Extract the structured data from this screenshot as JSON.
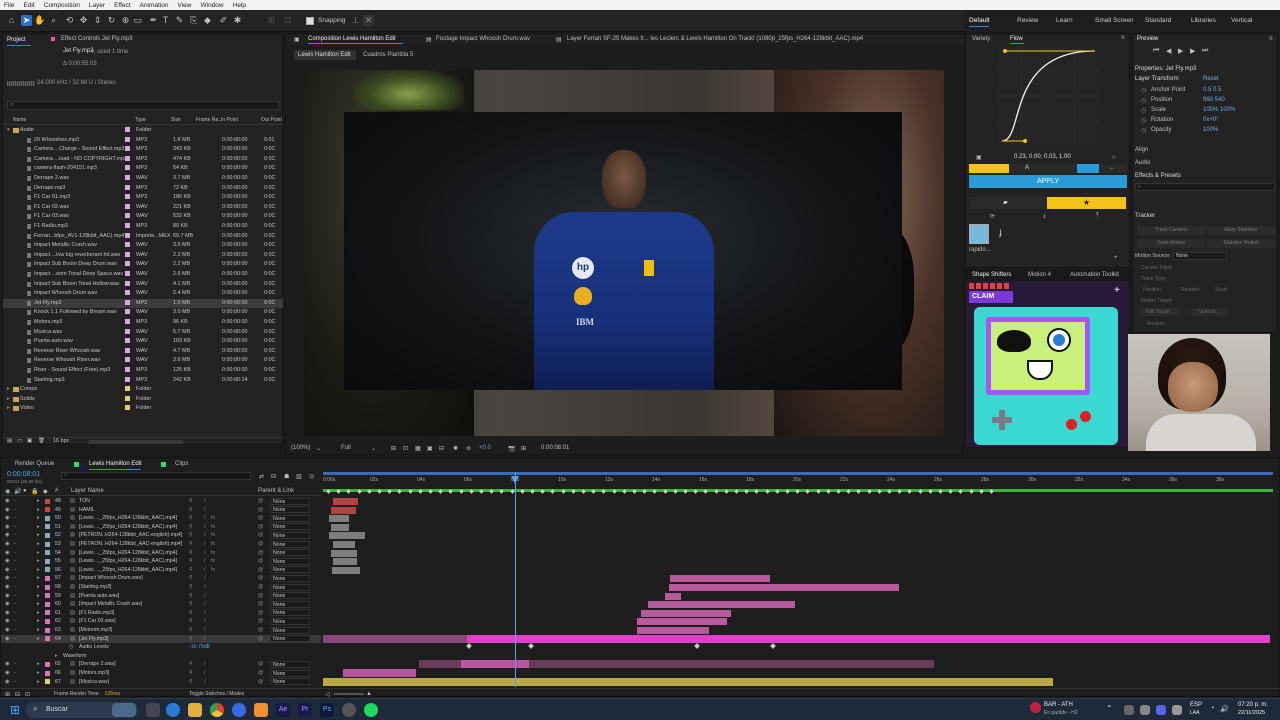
{
  "menu": [
    "File",
    "Edit",
    "Composition",
    "Layer",
    "Effect",
    "Animation",
    "View",
    "Window",
    "Help"
  ],
  "toolbar": {
    "snapping": "Snapping"
  },
  "workspaces": [
    "Default",
    "Review",
    "Learn",
    "Small Screen",
    "Standard",
    "Libraries",
    "Vertical"
  ],
  "project": {
    "tab": "Project",
    "effect_tab": "Effect Controls Jet Fly.mp3",
    "file_name": "Jet Fly.mp3",
    "file_used": "▾, used 1 time",
    "file_duration": "Δ 0:00:55:03",
    "file_info": "24.000 kHz / 32 bit U / Stereo",
    "headers": [
      "Name",
      "Type",
      "Size",
      "Frame Ra...",
      "In Point",
      "Out Point"
    ],
    "items": [
      {
        "name": "Audio",
        "type": "Folder",
        "size": "",
        "in": "",
        "out": "",
        "color": "#d9a8e0"
      },
      {
        "name": "20 Whooshes.mp3",
        "type": "MP3",
        "size": "1.8 MB",
        "in": "0:00:00:00",
        "out": "0:01",
        "color": "#d9a8e0"
      },
      {
        "name": "Camera ...Charge - Sound Effect.mp3",
        "type": "MP3",
        "size": "343 KB",
        "in": "0:00:00:00",
        "out": "0:0C",
        "color": "#d9a8e0"
      },
      {
        "name": "Camera ...load - NO COPYRIGHT.mp3",
        "type": "MP3",
        "size": "474 KB",
        "in": "0:00:00:00",
        "out": "0:0C",
        "color": "#d9a8e0"
      },
      {
        "name": "camera-flash-204151.mp3",
        "type": "MP3",
        "size": "54 KB",
        "in": "0:00:00:00",
        "out": "0:0C",
        "color": "#d9a8e0"
      },
      {
        "name": "Derrape 2.wav",
        "type": "WAV",
        "size": "3.7 MB",
        "in": "0:00:00:00",
        "out": "0:0C",
        "color": "#d9a8e0"
      },
      {
        "name": "Derrape.mp3",
        "type": "MP3",
        "size": "72 KB",
        "in": "0:00:00:00",
        "out": "0:0C",
        "color": "#d9a8e0"
      },
      {
        "name": "F1 Car 01.mp3",
        "type": "MP3",
        "size": "186 KB",
        "in": "0:00:00:00",
        "out": "0:0C",
        "color": "#d9a8e0"
      },
      {
        "name": "F1 Car 02.wav",
        "type": "WAV",
        "size": "221 KB",
        "in": "0:00:00:00",
        "out": "0:0C",
        "color": "#d9a8e0"
      },
      {
        "name": "F1 Car 03.wav",
        "type": "WAV",
        "size": "532 KB",
        "in": "0:00:00:00",
        "out": "0:0C",
        "color": "#d9a8e0"
      },
      {
        "name": "F1 Radio.mp3",
        "type": "MP3",
        "size": "80 KB",
        "in": "0:00:00:00",
        "out": "0:0C",
        "color": "#d9a8e0"
      },
      {
        "name": "Ferrari...bfps_AV1-128kbit_AAC).mp4",
        "type": "Importe...MEX",
        "size": "69.7 MB",
        "in": "0:00:00:00",
        "out": "0:0C",
        "color": "#d9a8e0"
      },
      {
        "name": "Impact Metallic Crash.wav",
        "type": "WAV",
        "size": "3.5 MB",
        "in": "0:00:00:00",
        "out": "0:0C",
        "color": "#d9a8e0"
      },
      {
        "name": "Impact ...low big reverberant hit.wav",
        "type": "WAV",
        "size": "2.3 MB",
        "in": "0:00:00:00",
        "out": "0:0C",
        "color": "#d9a8e0"
      },
      {
        "name": "Impact Sub Boom Deep Drum.wav",
        "type": "WAV",
        "size": "2.2 MB",
        "in": "0:00:00:00",
        "out": "0:0C",
        "color": "#d9a8e0"
      },
      {
        "name": "Impact ...oom Tonal Deep Space.wav",
        "type": "WAV",
        "size": "2.6 MB",
        "in": "0:00:00:00",
        "out": "0:0C",
        "color": "#d9a8e0"
      },
      {
        "name": "Impact Sub Boom Tonal Hollow.wav",
        "type": "WAV",
        "size": "4.1 MB",
        "in": "0:00:00:00",
        "out": "0:0C",
        "color": "#d9a8e0"
      },
      {
        "name": "Impact Whoosh Drum.wav",
        "type": "WAV",
        "size": "2.4 MB",
        "in": "0:00:00:00",
        "out": "0:0C",
        "color": "#d9a8e0"
      },
      {
        "name": "Jet Fly.mp3",
        "type": "MP3",
        "size": "1.0 MB",
        "in": "0:00:00:00",
        "out": "0:0C",
        "color": "#d9a8e0"
      },
      {
        "name": "Knock 1,1 Followed by Bream.wav",
        "type": "WAV",
        "size": "3.0 MB",
        "in": "0:00:00:00",
        "out": "0:0C",
        "color": "#d9a8e0"
      },
      {
        "name": "Motors.mp3",
        "type": "MP3",
        "size": "96 KB",
        "in": "0:00:00:00",
        "out": "0:0C",
        "color": "#d9a8e0"
      },
      {
        "name": "Musica.wav",
        "type": "WAV",
        "size": "5.7 MB",
        "in": "0:00:00:00",
        "out": "0:0C",
        "color": "#d9a8e0"
      },
      {
        "name": "Puerta auto.wav",
        "type": "WAV",
        "size": "183 KB",
        "in": "0:00:00:00",
        "out": "0:0C",
        "color": "#d9a8e0"
      },
      {
        "name": "Reverse Riser Whoosh.wav",
        "type": "WAV",
        "size": "4.7 MB",
        "in": "0:00:00:00",
        "out": "0:0C",
        "color": "#d9a8e0"
      },
      {
        "name": "Reverse Whoosh Riser.wav",
        "type": "WAV",
        "size": "3.6 MB",
        "in": "0:00:00:00",
        "out": "0:0C",
        "color": "#d9a8e0"
      },
      {
        "name": "Riser - Sound Effect (Free).mp3",
        "type": "MP3",
        "size": "125 KB",
        "in": "0:00:00:00",
        "out": "0:0C",
        "color": "#d9a8e0"
      },
      {
        "name": "Starting.mp3",
        "type": "MP3",
        "size": "242 KB",
        "in": "0:00:00:14",
        "out": "0:0C",
        "color": "#d9a8e0"
      },
      {
        "name": "Comps",
        "type": "Folder",
        "size": "",
        "in": "",
        "out": "",
        "color": "#e2d06a"
      },
      {
        "name": "Solids",
        "type": "Folder",
        "size": "",
        "in": "",
        "out": "",
        "color": "#e2d06a"
      },
      {
        "name": "Video",
        "type": "Folder",
        "size": "",
        "in": "",
        "out": "",
        "color": "#e2d06a"
      }
    ],
    "bpc": "16 bpc"
  },
  "composition": {
    "tabs": [
      "Composition Lewis Hamilton Edit",
      "Footage Impact Whoosh Drum.wav",
      "Layer Ferrari SF-25 Makes It... les Leclerc & Lewis Hamilton On Track! (1080p_25fps_H264-128kbit_AAC).mp4"
    ],
    "subtabs": [
      "Lewis Hamilton Edit",
      "Cuadros Plantilla 5"
    ],
    "zoom": "(100%)",
    "quality": "Full",
    "exposure": "+0.0",
    "timecode": "0:00:08:01"
  },
  "flow": {
    "tabs": [
      "Variety",
      "Flow"
    ],
    "values": "0.23, 0.00, 0.03, 1.00",
    "apply": "APPLY",
    "preset_label": "rapido...",
    "accent": "#2a9ad8",
    "yellow": "#f4c21a"
  },
  "preview": {
    "title": "Preview",
    "properties": "Properties: Jet Fly.mp3",
    "layer_transform": "Layer Transform",
    "reset": "Reset",
    "props": [
      {
        "label": "Anchor Point",
        "value": "0.5    0.5"
      },
      {
        "label": "Position",
        "value": "960    540"
      },
      {
        "label": "Scale",
        "value": "100%   100%"
      },
      {
        "label": "Rotation",
        "value": "0x+0°"
      },
      {
        "label": "Opacity",
        "value": "100%"
      }
    ],
    "align": "Align",
    "audio": "Audio",
    "effects": "Effects & Presets",
    "tracker": "Tracker",
    "tracker_buttons": [
      "Track Camera",
      "Warp Stabilizer",
      "Track Motion",
      "Stabilize Motion"
    ],
    "motion_source": "Motion Source:",
    "motion_source_value": "None",
    "current_track": "Current Track:",
    "track_type": "Track Type:",
    "position": "Position",
    "rotation": "Rotation",
    "scale": "Scale",
    "motion_target": "Motion Target:",
    "edit_target": "Edit Target...",
    "options": "Options...",
    "analyze": "Analyze:"
  },
  "shapes": {
    "tabs": [
      "Shape Shifters",
      "Motion 4",
      "Automation Toolkit"
    ],
    "claim": "CLAIM"
  },
  "timeline": {
    "tabs": [
      "Render Queue",
      "Lewis Hamilton Edit",
      "Clips"
    ],
    "timecode": "0:00:08:01",
    "sub_timecode": "00201 (25.00 fps)",
    "header": [
      "#",
      "Layer Name",
      "Parent & Link"
    ],
    "ruler": [
      "0:00s",
      "02s",
      "04s",
      "06s",
      "08s",
      "10s",
      "12s",
      "14s",
      "16s",
      "18s",
      "20s",
      "22s",
      "24s",
      "26s",
      "28s",
      "30s",
      "32s",
      "34s",
      "36s",
      "38s"
    ],
    "layers": [
      {
        "n": "48",
        "name": "TON",
        "color": "#c44"
      },
      {
        "n": "49",
        "name": "HAMIL",
        "color": "#c44"
      },
      {
        "n": "50",
        "name": "[Lewis ..._25fps_H264-128kbit_AAC).mp4]",
        "color": "#8ab"
      },
      {
        "n": "51",
        "name": "[Lewis ..._25fps_H264-128kbit_AAC).mp4]",
        "color": "#8ab"
      },
      {
        "n": "52",
        "name": "[PETRON..H264-128kbit_AAC-english).mp4]",
        "color": "#8ab"
      },
      {
        "n": "53",
        "name": "[PETRON..H264-128kbit_AAC-english).mp4]",
        "color": "#8ab"
      },
      {
        "n": "54",
        "name": "[Lewis ..._25fps_H264-128kbit_AAC).mp4]",
        "color": "#8ab"
      },
      {
        "n": "55",
        "name": "[Lewis ..._25fps_H264-128kbit_AAC).mp4]",
        "color": "#8ab"
      },
      {
        "n": "56",
        "name": "[Lewis ..._25fps_H264-128kbit_AAC).mp4]",
        "color": "#8ab"
      },
      {
        "n": "57",
        "name": "[Impact Whoosh Drum.wav]",
        "color": "#d7a"
      },
      {
        "n": "58",
        "name": "[Starting.mp3]",
        "color": "#d7a"
      },
      {
        "n": "59",
        "name": "[Puerta auto.wav]",
        "color": "#d7a"
      },
      {
        "n": "60",
        "name": "[Impact Metallic Crash.wav]",
        "color": "#d7a"
      },
      {
        "n": "61",
        "name": "[F1 Radio.mp3]",
        "color": "#d7a"
      },
      {
        "n": "62",
        "name": "[F1 Car 03.wav]",
        "color": "#d7a"
      },
      {
        "n": "63",
        "name": "[Motoren.mp3]",
        "color": "#d7a"
      },
      {
        "n": "64",
        "name": "[Jet Fly.mp3]",
        "color": "#d7a"
      }
    ],
    "audio_levels_label": "Audio Levels",
    "audio_levels_value": "-10.79dB",
    "waveform_label": "Waveform",
    "layers2": [
      {
        "n": "65",
        "name": "[Derrape 2.wav]",
        "color": "#d7a"
      },
      {
        "n": "66",
        "name": "[Motors.mp3]",
        "color": "#d7a"
      },
      {
        "n": "67",
        "name": "[Musica.wav]",
        "color": "#e2d06a"
      }
    ],
    "parent_none": "None",
    "render_time": "Frame Render Time:",
    "render_time_value": "535ms",
    "toggle": "Toggle Switches / Modes"
  },
  "taskbar": {
    "search": "Buscar",
    "match": "BAR - ATH",
    "match_sub": "En partido - H2",
    "lang": "ESP",
    "lang_sub": "LAA",
    "time": "07:20 p. m.",
    "date": "22/11/2025"
  }
}
